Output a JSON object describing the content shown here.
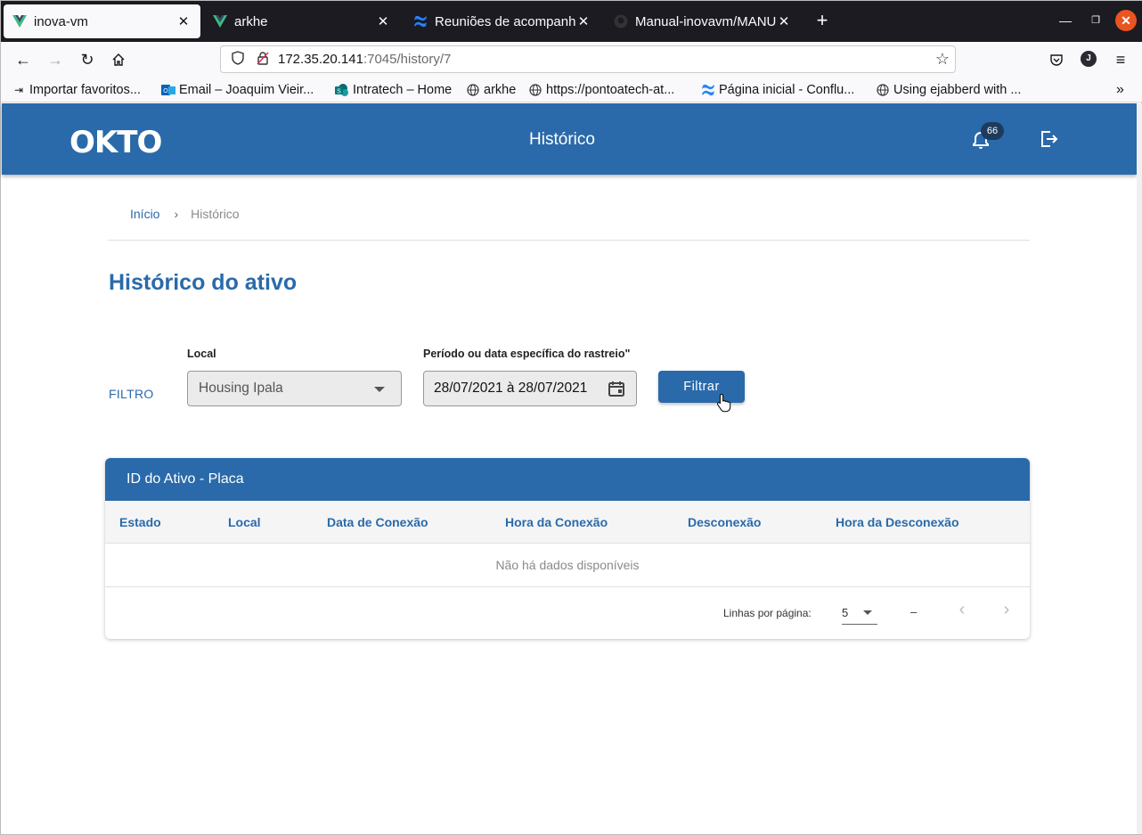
{
  "browser": {
    "tabs": [
      {
        "title": "inova-vm",
        "favicon": "vue-logo-icon",
        "active": true
      },
      {
        "title": "arkhe",
        "favicon": "vue-logo-icon",
        "active": false
      },
      {
        "title": "Reuniões de acompanhar",
        "favicon": "confluence-icon",
        "active": false
      },
      {
        "title": "Manual-inovavm/MANUA",
        "favicon": "github-icon",
        "active": false
      }
    ],
    "new_tab_label": "+",
    "url_host": "172.35.20.141",
    "url_path": ":7045/history/7",
    "profile_initial": "J",
    "bookmarks": [
      {
        "label": "Importar favoritos...",
        "icon": "import-icon"
      },
      {
        "label": "Email – Joaquim Vieir...",
        "icon": "outlook-icon"
      },
      {
        "label": "Intratech – Home",
        "icon": "sharepoint-icon"
      },
      {
        "label": "arkhe",
        "icon": "globe-icon"
      },
      {
        "label": "https://pontoatech-at...",
        "icon": "globe-icon"
      },
      {
        "label": "Página inicial - Conflu...",
        "icon": "confluence-icon"
      },
      {
        "label": "Using ejabberd with ...",
        "icon": "globe-icon"
      }
    ]
  },
  "app": {
    "logo_text": "OKTO",
    "header_title": "Histórico",
    "notification_count": "66",
    "brand_color": "#2a6aaa"
  },
  "breadcrumb": {
    "home": "Início",
    "separator": "›",
    "current": "Histórico"
  },
  "page_title": "Histórico do ativo",
  "filter": {
    "label": "FILTRO",
    "local_label": "Local",
    "local_value": "Housing Ipala",
    "period_label": "Período ou data específica do rastreio\"",
    "period_value": "28/07/2021 à 28/07/2021",
    "submit_label": "Filtrar"
  },
  "table": {
    "title": "ID do Ativo - Placa",
    "columns": [
      "Estado",
      "Local",
      "Data de Conexão",
      "Hora da Conexão",
      "Desconexão",
      "Hora da Desconexão"
    ],
    "rows": [],
    "empty_message": "Não há dados disponíveis",
    "rows_per_page_label": "Linhas por página:",
    "rows_per_page_value": "5",
    "range_text": "–"
  }
}
